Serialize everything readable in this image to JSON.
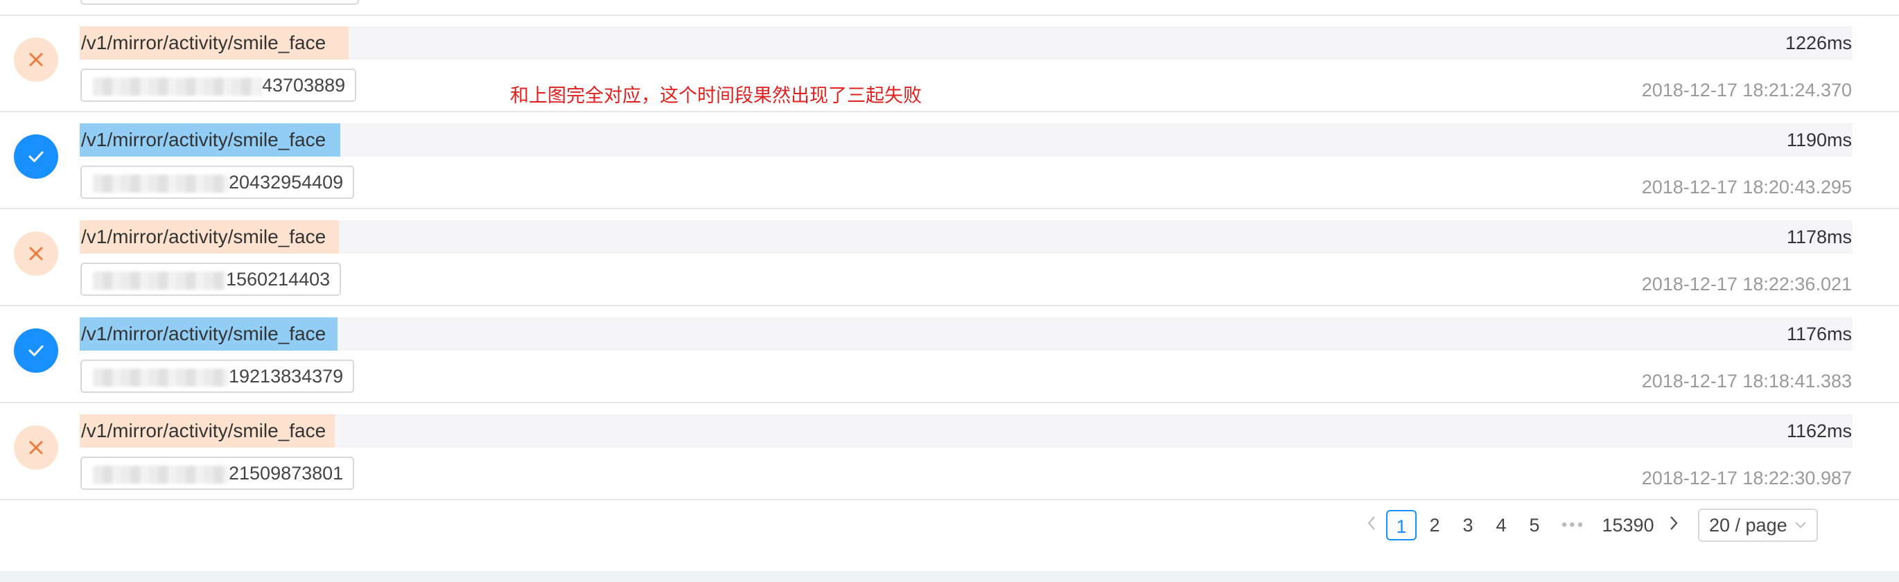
{
  "rows": [
    {
      "status": "fail",
      "path": "/v1/mirror/activity/smile_face",
      "duration": "1226ms",
      "id_suffix": "43703889",
      "timestamp": "2018-12-17 18:21:24.370",
      "note": "和上图完全对应，这个时间段果然出现了三起失败"
    },
    {
      "status": "success",
      "path": "/v1/mirror/activity/smile_face",
      "duration": "1190ms",
      "id_suffix": "20432954409",
      "timestamp": "2018-12-17 18:20:43.295"
    },
    {
      "status": "fail",
      "path": "/v1/mirror/activity/smile_face",
      "duration": "1178ms",
      "id_suffix": "1560214403",
      "timestamp": "2018-12-17 18:22:36.021"
    },
    {
      "status": "success",
      "path": "/v1/mirror/activity/smile_face",
      "duration": "1176ms",
      "id_suffix": "19213834379",
      "timestamp": "2018-12-17 18:18:41.383"
    },
    {
      "status": "fail",
      "path": "/v1/mirror/activity/smile_face",
      "duration": "1162ms",
      "id_suffix": "21509873801",
      "timestamp": "2018-12-17 18:22:30.987"
    }
  ],
  "pagination": {
    "prev_icon": "chevron-left-icon",
    "pages": [
      "1",
      "2",
      "3",
      "4",
      "5"
    ],
    "current": "1",
    "ellipsis": "•••",
    "last": "15390",
    "next_icon": "chevron-right-icon",
    "page_size": "20 / page"
  },
  "colors": {
    "fail_bg": "#fde3cf",
    "fail_icon": "#f07b3f",
    "success": "#1890ff",
    "path_highlight_ok": "#91cdf4",
    "note": "#e0201e"
  }
}
